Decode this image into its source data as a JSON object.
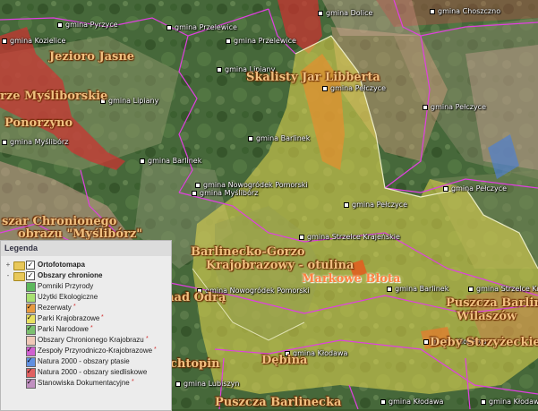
{
  "legend": {
    "title": "Legenda",
    "groups": [
      {
        "label": "Ortofotomapa",
        "checked": true,
        "expander": "+"
      },
      {
        "label": "Obszary chronione",
        "checked": true,
        "expander": "-"
      }
    ],
    "items": [
      {
        "label": "Pomniki Przyrody",
        "checked": false,
        "color": "#5cb85c",
        "star": ""
      },
      {
        "label": "Użytki Ekologiczne",
        "checked": false,
        "color": "#a8e070",
        "star": ""
      },
      {
        "label": "Rezerwaty",
        "checked": true,
        "color": "#e89a40",
        "star": "*"
      },
      {
        "label": "Parki Krajobrazowe",
        "checked": true,
        "color": "#e8e060",
        "star": "*"
      },
      {
        "label": "Parki Narodowe",
        "checked": true,
        "color": "#7cc070",
        "star": "*"
      },
      {
        "label": "Obszary Chronionego Krajobrazu",
        "checked": false,
        "color": "#f0c8b8",
        "star": "*"
      },
      {
        "label": "Zespoły Przyrodniczo-Krajobrazowe",
        "checked": true,
        "color": "#d060d0",
        "star": "*"
      },
      {
        "label": "Natura 2000 - obszary ptasie",
        "checked": true,
        "color": "#6090e0",
        "star": ""
      },
      {
        "label": "Natura 2000 - obszary siedliskowe",
        "checked": true,
        "color": "#e06060",
        "star": ""
      },
      {
        "label": "Stanowiska Dokumentacyjne",
        "checked": true,
        "color": "#c090c0",
        "star": "*"
      }
    ]
  },
  "map": {
    "gmina_labels": [
      "gmina Kozielice",
      "gmina Pyrzyce",
      "gmina Przelewice",
      "gmina Przelewice",
      "gmina Dolice",
      "gmina Choszczno",
      "gmina Lipiany",
      "gmina Lipiany",
      "gmina Pełczyce",
      "gmina Pełczyce",
      "gmina Myślibórz",
      "gmina Barlinek",
      "gmina Barlinek",
      "gmina Nowogródek Pomorski",
      "gmina Myślibórz",
      "gmina Pełczyce",
      "gmina Pełczyce",
      "gmina Strzelce Krajeńskie",
      "gmina Nowogródek Pomorski",
      "gmina Barlinek",
      "gmina Strzelce Krajeńskie",
      "gmina Kłodawa",
      "gmina Kłodawa",
      "gmina Lubiszyn",
      "gmina Kłodawa",
      "gmina Kłodawa"
    ],
    "area_labels": [
      "Jezioro Jasne",
      "rze Myśliborskie",
      "Skalisty Jar Libberta",
      "Ponorzyno",
      "szar Chronionego",
      "obrazu \"Myślibórz\"",
      "Barlinecko-Gorzo",
      "Krajobrazowy - otulina",
      "Markowe Błota",
      "Puszcza Barlinec",
      "Wilaszów",
      "Dęby Strzyżeckie",
      "Dębina",
      "Puszcza Barlinecka",
      "szczy nad Odrą",
      "chtopin"
    ]
  }
}
